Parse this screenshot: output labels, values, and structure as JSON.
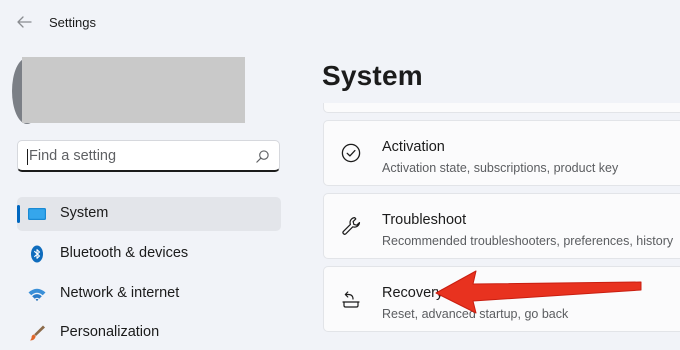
{
  "app": {
    "title": "Settings"
  },
  "search": {
    "placeholder": "Find a setting"
  },
  "sidebar": {
    "items": [
      {
        "label": "System",
        "active": true
      },
      {
        "label": "Bluetooth & devices"
      },
      {
        "label": "Network & internet"
      },
      {
        "label": "Personalization"
      }
    ]
  },
  "main": {
    "title": "System",
    "cards": [
      {
        "title": "Activation",
        "subtitle": "Activation state, subscriptions, product key",
        "icon": "checkmark-circle-icon"
      },
      {
        "title": "Troubleshoot",
        "subtitle": "Recommended troubleshooters, preferences, history",
        "icon": "wrench-icon"
      },
      {
        "title": "Recovery",
        "subtitle": "Reset, advanced startup, go back",
        "icon": "recovery-icon"
      }
    ]
  },
  "annotation": {
    "arrow_color": "#e8321f",
    "points_to": "Recovery"
  },
  "colors": {
    "accent": "#0067c0",
    "background": "#f1f3f8"
  }
}
